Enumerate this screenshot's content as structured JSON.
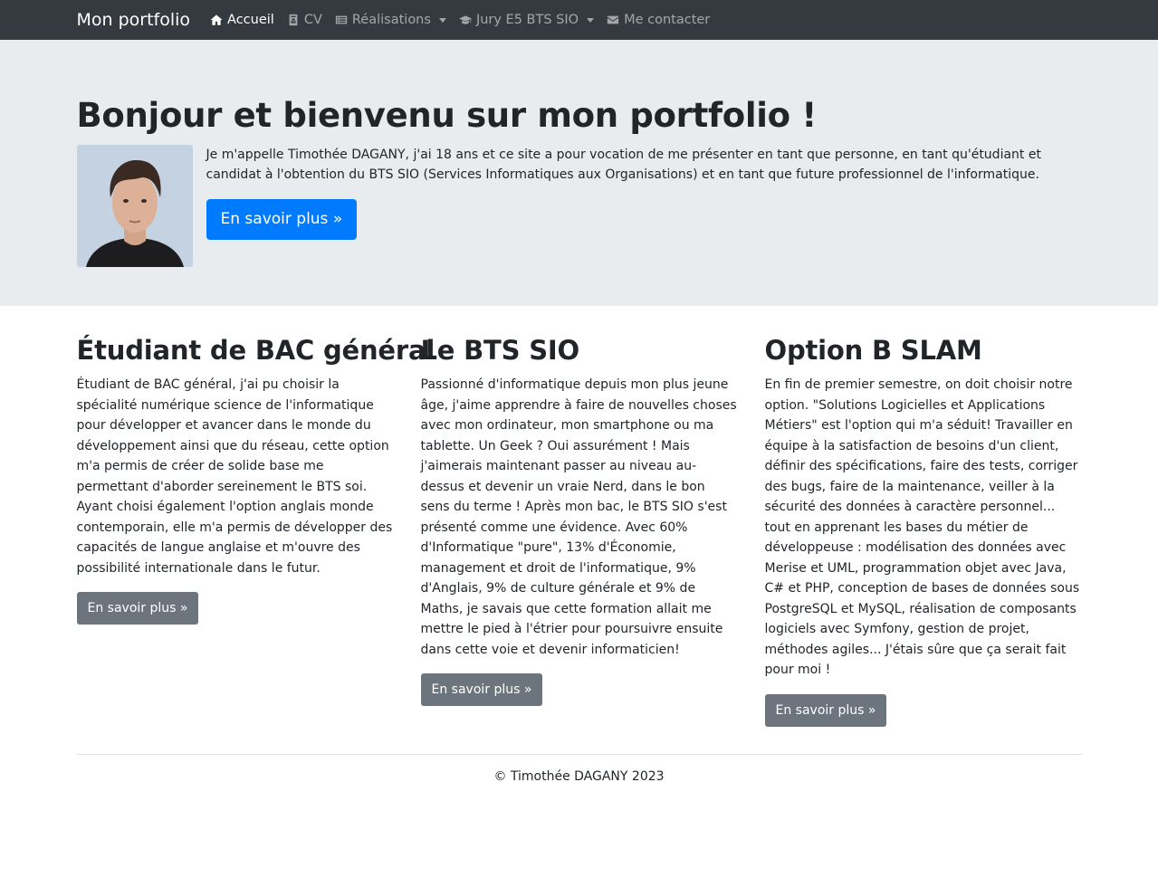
{
  "navbar": {
    "brand": "Mon portfolio",
    "items": [
      {
        "label": "Accueil",
        "icon": "home-icon",
        "active": true,
        "dropdown": false
      },
      {
        "label": "CV",
        "icon": "id-card-icon",
        "active": false,
        "dropdown": false
      },
      {
        "label": "Réalisations",
        "icon": "list-icon",
        "active": false,
        "dropdown": true
      },
      {
        "label": "Jury E5 BTS SIO",
        "icon": "graduation-cap-icon",
        "active": false,
        "dropdown": true
      },
      {
        "label": "Me contacter",
        "icon": "envelope-icon",
        "active": false,
        "dropdown": false
      }
    ]
  },
  "jumbotron": {
    "title": "Bonjour et bienvenu sur mon portfolio !",
    "text": "Je m'appelle Timothée DAGANY, j'ai 18 ans et ce site a pour vocation de me présenter en tant que personne, en tant qu'étudiant et candidat à l'obtention du BTS SIO (Services Informatiques aux Organisations) et en tant que future professionnel de l'informatique.",
    "button": "En savoir plus »"
  },
  "columns": [
    {
      "title": "Étudiant de BAC général",
      "text": "Étudiant de BAC général, j'ai pu choisir la spécialité numérique science de l'informatique pour développer et avancer dans le monde du développement ainsi que du réseau, cette option m'a permis de créer de solide base me permettant d'aborder sereinement le BTS soi. Ayant choisi également l'option anglais monde contemporain, elle m'a permis de développer des capacités de langue anglaise et m'ouvre des possibilité internationale dans le futur.",
      "button": "En savoir plus »"
    },
    {
      "title": "Le BTS SIO",
      "text": "Passionné d'informatique depuis mon plus jeune âge, j'aime apprendre à faire de nouvelles choses avec mon ordinateur, mon smartphone ou ma tablette. Un Geek ? Oui assurément ! Mais j'aimerais maintenant passer au niveau au-dessus et devenir un vraie Nerd, dans le bon sens du terme ! Après mon bac, le BTS SIO s'est présenté comme une évidence. Avec 60% d'Informatique \"pure\", 13% d'Économie, management et droit de l'informatique, 9% d'Anglais, 9% de culture générale et 9% de Maths, je savais que cette formation allait me mettre le pied à l'étrier pour poursuivre ensuite dans cette voie et devenir informaticien!",
      "button": "En savoir plus »"
    },
    {
      "title": "Option B SLAM",
      "text": "En fin de premier semestre, on doit choisir notre option. \"Solutions Logicielles et Applications Métiers\" est l'option qui m'a séduit! Travailler en équipe à la satisfaction de besoins d'un client, définir des spécifications, faire des tests, corriger des bugs, faire de la maintenance, veiller à la sécurité des données à caractère personnel... tout en apprenant les bases du métier de développeuse : modélisation des données avec Merise et UML, programmation objet avec Java, C# et PHP, conception de bases de données sous PostgreSQL et MySQL, réalisation de composants logiciels avec Symfony, gestion de projet, méthodes agiles... J'étais sûre que ça serait fait pour moi !",
      "button": "En savoir plus »"
    }
  ],
  "footer": {
    "text": "© Timothée DAGANY 2023"
  },
  "colors": {
    "navbar_bg": "#343a40",
    "jumbotron_bg": "#e9ecef",
    "primary": "#007bff",
    "secondary": "#6c757d"
  }
}
